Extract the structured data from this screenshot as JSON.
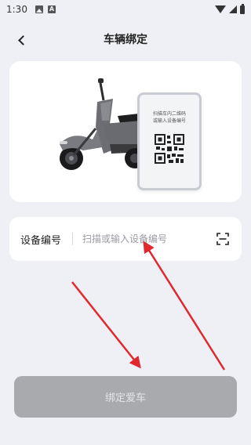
{
  "status_bar": {
    "time": "1:30"
  },
  "header": {
    "title": "车辆绑定",
    "back_icon": "chevron-left-icon"
  },
  "hero": {
    "qr_hint_line1": "扫描车内二维码",
    "qr_hint_line2": "或输入设备编号"
  },
  "device_field": {
    "label": "设备编号",
    "value": "",
    "placeholder": "扫描或输入设备编号",
    "scan_icon": "scan-icon"
  },
  "bind_button": {
    "label": "绑定爱车"
  },
  "colors": {
    "background": "#eff0f5",
    "card": "#ffffff",
    "button_disabled": "#a9aaad",
    "annotation_arrow": "#e0282d"
  }
}
